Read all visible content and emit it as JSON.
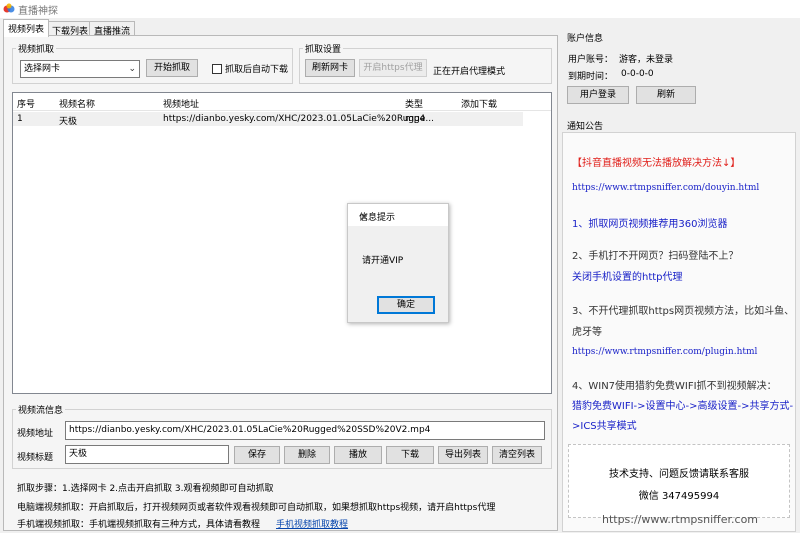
{
  "window": {
    "title": "直播神探"
  },
  "tabs": [
    {
      "label": "视频列表"
    },
    {
      "label": "下载列表"
    },
    {
      "label": "直播推流"
    }
  ],
  "capture": {
    "group_label": "视频抓取",
    "nic_select": "选择网卡",
    "start_button": "开始抓取",
    "auto_download": "抓取后自动下载"
  },
  "settings": {
    "group_label": "抓取设置",
    "refresh_nic": "刷新网卡",
    "enable_https_proxy": "开启https代理",
    "status": "正在开启代理模式"
  },
  "table": {
    "headers": [
      "序号",
      "视频名称",
      "视频地址",
      "类型",
      "添加下载"
    ],
    "rows": [
      {
        "index": "1",
        "name": "天极",
        "url": "https://dianbo.yesky.com/XHC/2023.01.05LaCie%20Rugge...",
        "type": "mp4",
        "add": ""
      }
    ]
  },
  "dialog": {
    "title": "信息提示",
    "message": "请开通VIP",
    "ok": "确定",
    "close_icon": "close-icon"
  },
  "stream_info": {
    "group_label": "视频流信息",
    "url_label": "视频地址",
    "url_value": "https://dianbo.yesky.com/XHC/2023.01.05LaCie%20Rugged%20SSD%20V2.mp4",
    "title_label": "视频标题",
    "title_value": "天极",
    "buttons": {
      "save": "保存",
      "delete": "删除",
      "play": "播放",
      "download": "下载",
      "export": "导出列表",
      "clear": "清空列表"
    }
  },
  "help": {
    "steps": "抓取步骤：1.选择网卡  2.点击开启抓取  3.观看视频即可自动抓取",
    "pc": "电脑端视频抓取：开启抓取后，打开视频网页或者软件观看视频即可自动抓取，如果想抓取https视频，请开启https代理",
    "mobile": "手机端视频抓取：手机端视频抓取有三种方式，具体请看教程",
    "mobile_link": "手机视频抓取教程"
  },
  "account": {
    "label": "账户信息",
    "user_label": "用户账号：",
    "user_value": "游客，未登录",
    "expire_label": "到期时间：",
    "expire_value": "0-0-0-0",
    "login_button": "用户登录",
    "refresh_button": "刷新"
  },
  "notice": {
    "label": "通知公告",
    "items": [
      "【抖音直播视频无法播放解决方法↓】",
      "https://www.rtmpsniffer.com/douyin.html",
      "1、抓取网页视频推荐用360浏览器",
      "2、手机打不开网页？扫码登陆不上？",
      "关闭手机设置的http代理",
      "3、不开代理抓取https网页视频方法，比如斗鱼、",
      "虎牙等",
      "https://www.rtmpsniffer.com/plugin.html",
      "4、WIN7使用猎豹免费WIFI抓不到视频解决：",
      "猎豹免费WIFI->设置中心->高级设置->共享方式-",
      ">ICS共享模式"
    ],
    "support_line": "技术支持、问题反馈请联系客服",
    "wechat": "微信 347495994"
  },
  "footer_url": "https://www.rtmpsniffer.com",
  "colors": {
    "accent": "#0078d7",
    "notice_red": "#e0201b",
    "notice_blue": "#1a22c8"
  }
}
